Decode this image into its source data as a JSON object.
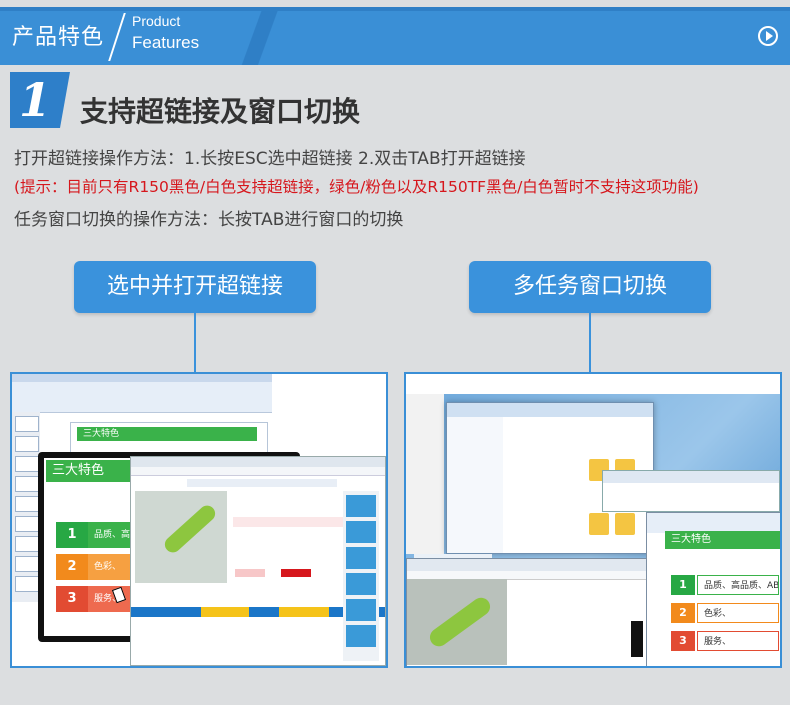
{
  "header": {
    "title_cn": "产品特色",
    "title_en_line1": "Product",
    "title_en_line2": "Features",
    "play_icon": "play-circle-icon"
  },
  "section": {
    "number": "1",
    "title": "支持超链接及窗口切换"
  },
  "body": {
    "line1": "打开超链接操作方法：1.长按ESC选中超链接  2.双击TAB打开超链接",
    "line2": "(提示：目前只有R150黑色/白色支持超链接，绿色/粉色以及R150TF黑色/白色暂时不支持这项功能)",
    "line3": "任务窗口切换的操作方法：长按TAB进行窗口的切换"
  },
  "labels": {
    "left": "选中并打开超链接",
    "right": "多任务窗口切换"
  },
  "screenshot_left": {
    "slide_heading": "三大特色",
    "features": [
      {
        "num": "1",
        "text": "品质、高",
        "color": "#27a844"
      },
      {
        "num": "2",
        "text": "色彩、",
        "color": "#f28a1c"
      },
      {
        "num": "3",
        "text": "服务、",
        "color": "#e24b32"
      }
    ]
  },
  "screenshot_right": {
    "slide_heading": "三大特色",
    "features": [
      {
        "num": "1",
        "text": "品质、高品质、ABS材质、质感",
        "color": "#27a844"
      },
      {
        "num": "2",
        "text": "色彩、",
        "color": "#f28a1c"
      },
      {
        "num": "3",
        "text": "服务、",
        "color": "#e24b32"
      }
    ]
  },
  "colors": {
    "brand_blue": "#3a8fd6",
    "accent_green": "#3ab24a",
    "notice_red": "#d6171d"
  }
}
